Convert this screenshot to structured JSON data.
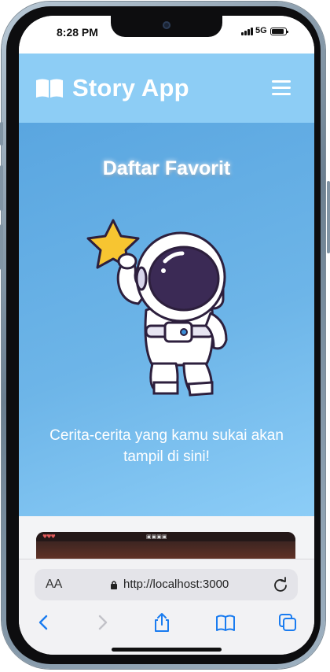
{
  "status_bar": {
    "time": "8:28 PM",
    "network": "5G"
  },
  "header": {
    "app_title": "Story App"
  },
  "hero": {
    "title": "Daftar Favorit",
    "message": "Cerita-cerita yang kamu sukai akan tampil di sini!"
  },
  "browser": {
    "text_size_label": "AA",
    "url": "http://localhost:3000"
  },
  "colors": {
    "header_bg": "#8dcdf5",
    "hero_gradient_start": "#5aa6e0",
    "hero_gradient_end": "#8ccdf7",
    "accent_blue": "#1a7cf0"
  },
  "icons": {
    "logo": "book-open-icon",
    "menu": "hamburger-menu-icon",
    "lock": "lock-icon",
    "reload": "reload-icon",
    "back": "chevron-left-icon",
    "forward": "chevron-right-icon",
    "share": "share-icon",
    "bookmarks": "book-icon",
    "tabs": "tabs-icon"
  }
}
